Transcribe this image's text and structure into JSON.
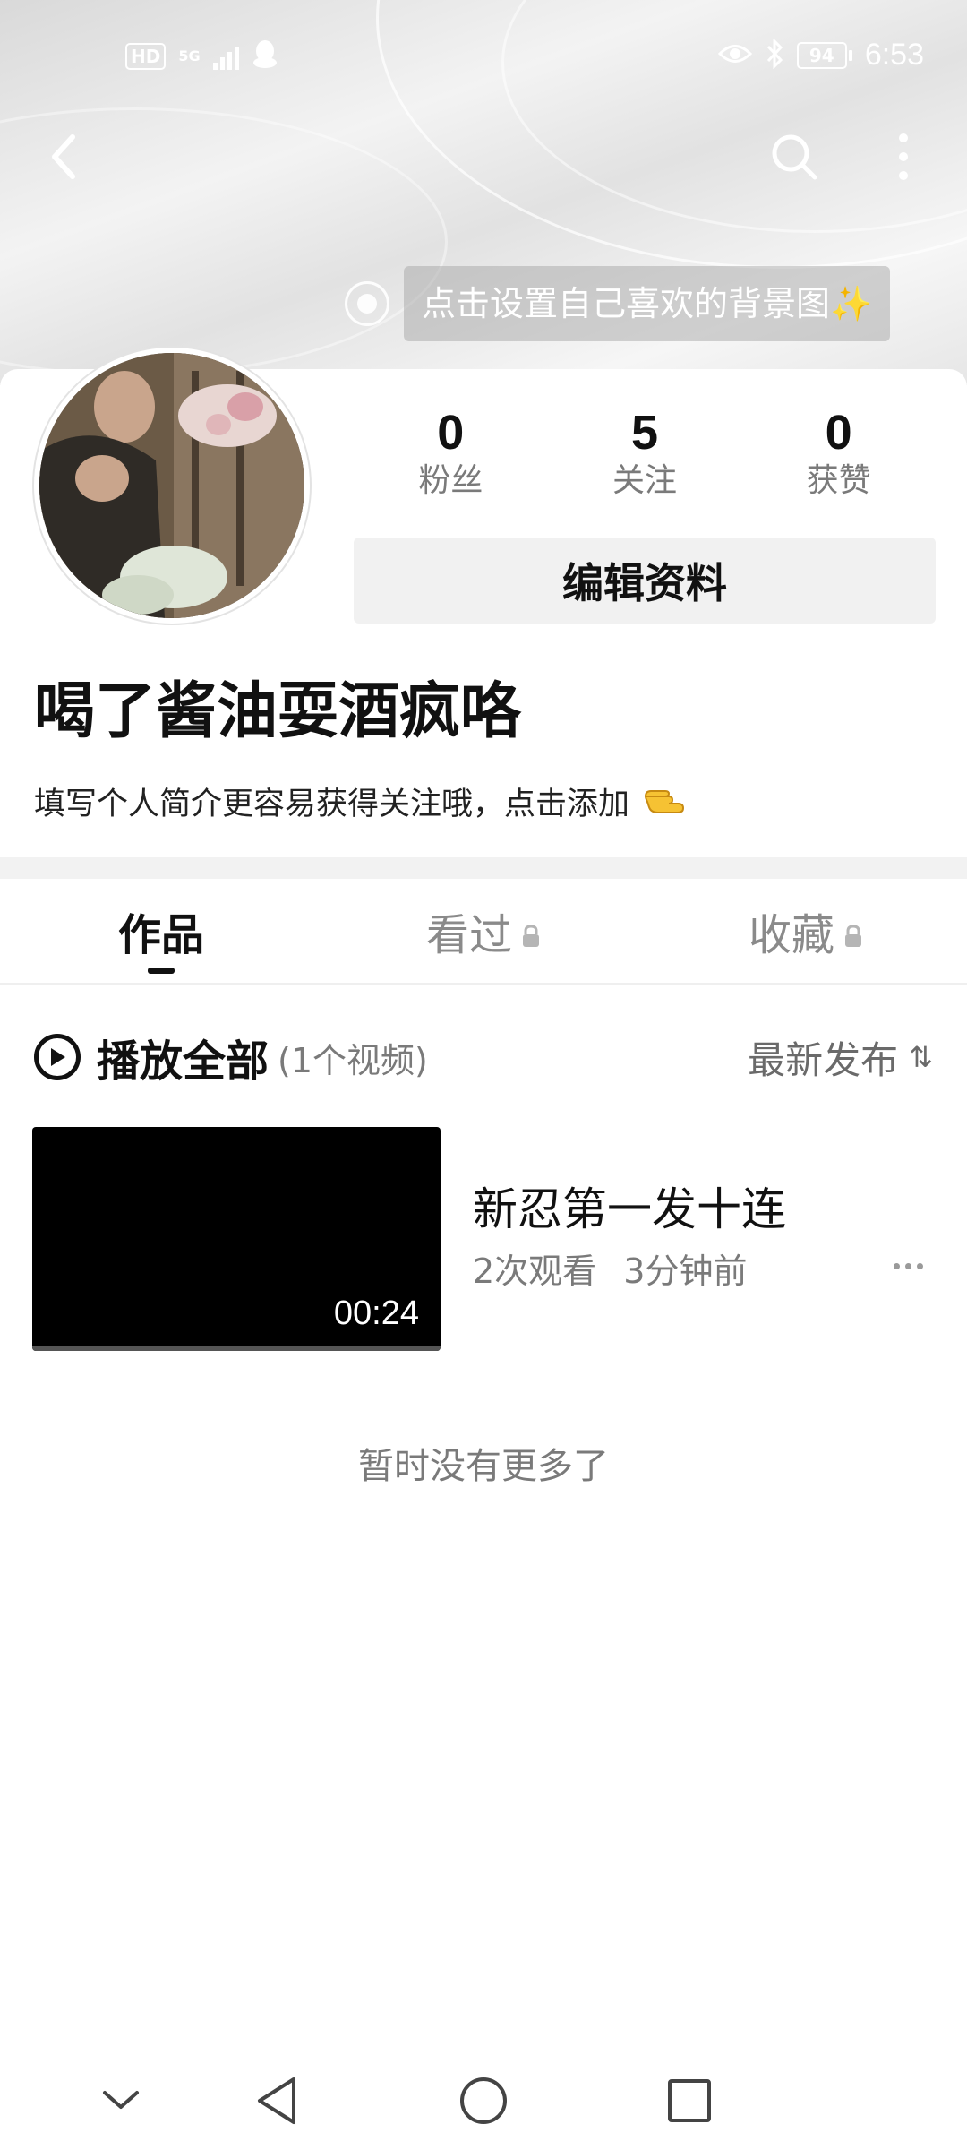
{
  "status_bar": {
    "hd": "HD",
    "network": "5G",
    "battery": "94",
    "time": "6:53"
  },
  "header": {
    "back_icon": "back-arrow-icon",
    "search_icon": "search-icon",
    "more_icon": "more-vertical-icon"
  },
  "background_hint": {
    "label": "点击设置自己喜欢的背景图✨"
  },
  "profile": {
    "username": "喝了酱油耍酒疯咯",
    "bio": "填写个人简介更容易获得关注哦，点击添加",
    "bio_emoji": "👈",
    "edit_button": "编辑资料",
    "stats": [
      {
        "value": "0",
        "label": "粉丝"
      },
      {
        "value": "5",
        "label": "关注"
      },
      {
        "value": "0",
        "label": "获赞"
      }
    ]
  },
  "tabs": [
    {
      "label": "作品",
      "active": true,
      "locked": false
    },
    {
      "label": "看过",
      "active": false,
      "locked": true
    },
    {
      "label": "收藏",
      "active": false,
      "locked": true
    }
  ],
  "list_header": {
    "play_all": "播放全部",
    "count": "(1个视频)",
    "sort": "最新发布",
    "sort_icon": "⇅"
  },
  "videos": [
    {
      "title": "新忍第一发十连",
      "views": "2次观看",
      "time": "3分钟前",
      "duration": "00:24"
    }
  ],
  "footer_note": "暂时没有更多了",
  "colors": {
    "text_primary": "#111111",
    "text_secondary": "#7a7a7a",
    "button_bg": "#f1f1f1"
  }
}
